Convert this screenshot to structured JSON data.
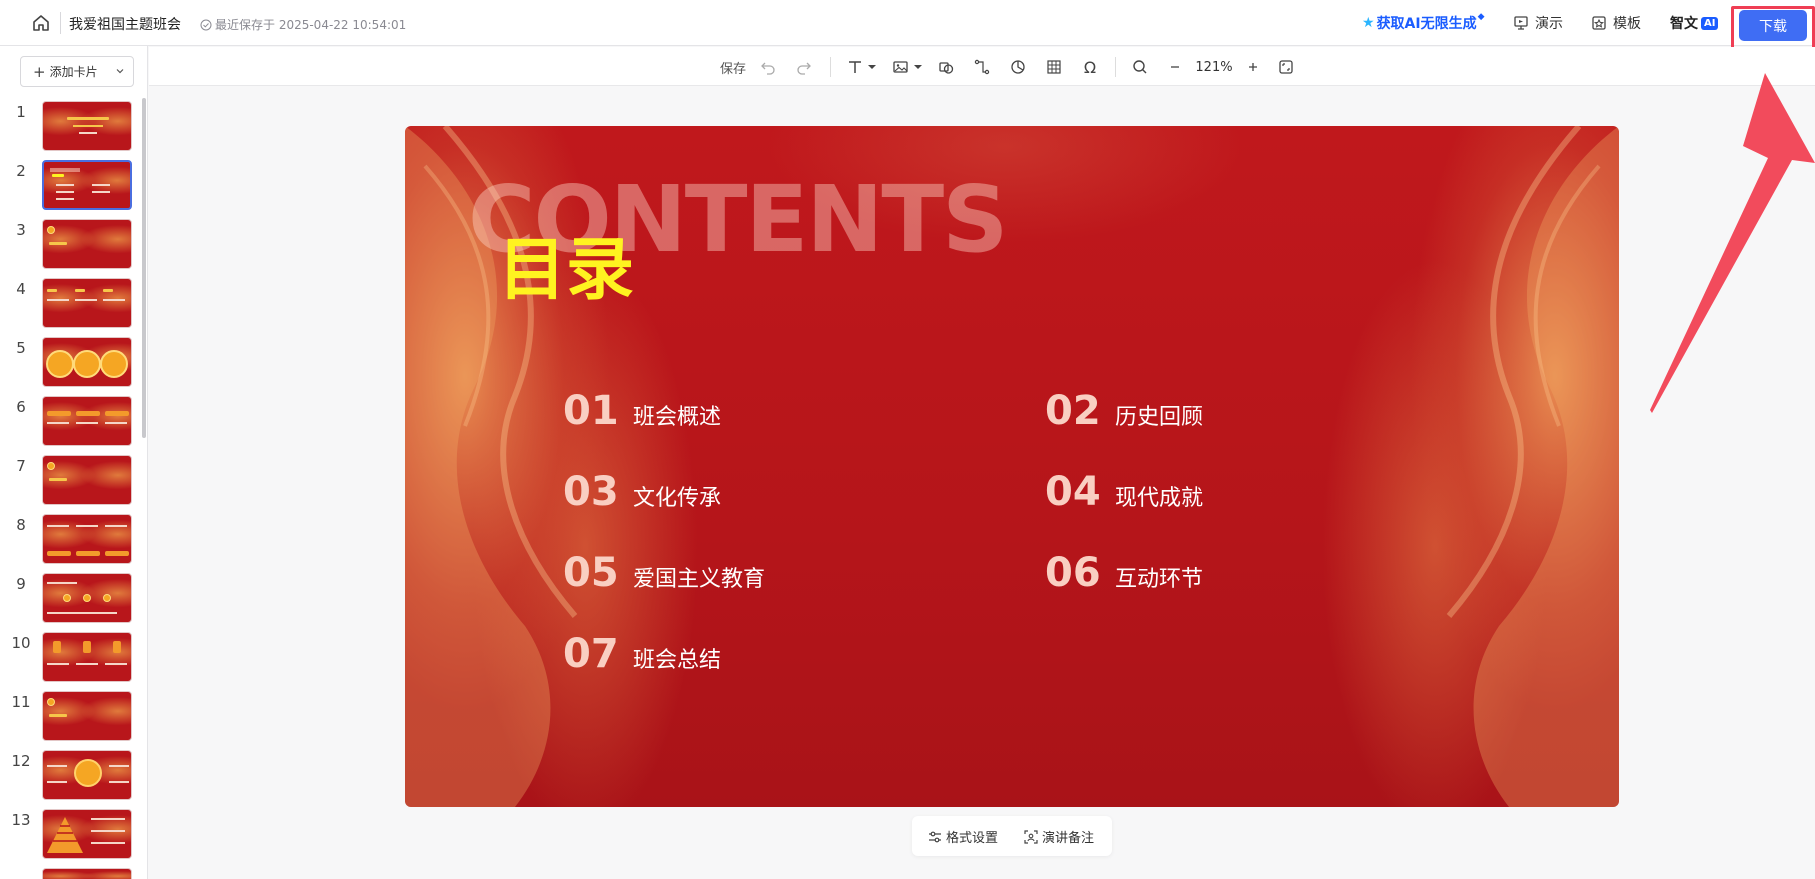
{
  "header": {
    "doc_title": "我爱祖国主题班会",
    "save_status": "最近保存于 2025-04-22 10:54:01",
    "ai_promo": "获取AI无限生成",
    "present_label": "演示",
    "template_label": "模板",
    "zhiwen_label": "智文",
    "ai_badge": "AI",
    "download_label": "下载"
  },
  "sidebar": {
    "add_card_label": "添加卡片",
    "slides": [
      {
        "num": "1"
      },
      {
        "num": "2"
      },
      {
        "num": "3"
      },
      {
        "num": "4"
      },
      {
        "num": "5"
      },
      {
        "num": "6"
      },
      {
        "num": "7"
      },
      {
        "num": "8"
      },
      {
        "num": "9"
      },
      {
        "num": "10"
      },
      {
        "num": "11"
      },
      {
        "num": "12"
      },
      {
        "num": "13"
      }
    ],
    "active_slide": 2
  },
  "toolbar": {
    "save_label": "保存",
    "zoom_level": "121%"
  },
  "slide": {
    "bg_word": "CONTENTS",
    "title": "目录",
    "items": [
      {
        "num": "01",
        "text": "班会概述"
      },
      {
        "num": "02",
        "text": "历史回顾"
      },
      {
        "num": "03",
        "text": "文化传承"
      },
      {
        "num": "04",
        "text": "现代成就"
      },
      {
        "num": "05",
        "text": "爱国主义教育"
      },
      {
        "num": "06",
        "text": "互动环节"
      },
      {
        "num": "07",
        "text": "班会总结"
      }
    ]
  },
  "bottom_bar": {
    "format_label": "格式设置",
    "notes_label": "演讲备注"
  },
  "colors": {
    "accent": "#3f6df4",
    "slide_red": "#b8161b",
    "title_yellow": "#fff320",
    "highlight_red": "#ef3e54"
  }
}
